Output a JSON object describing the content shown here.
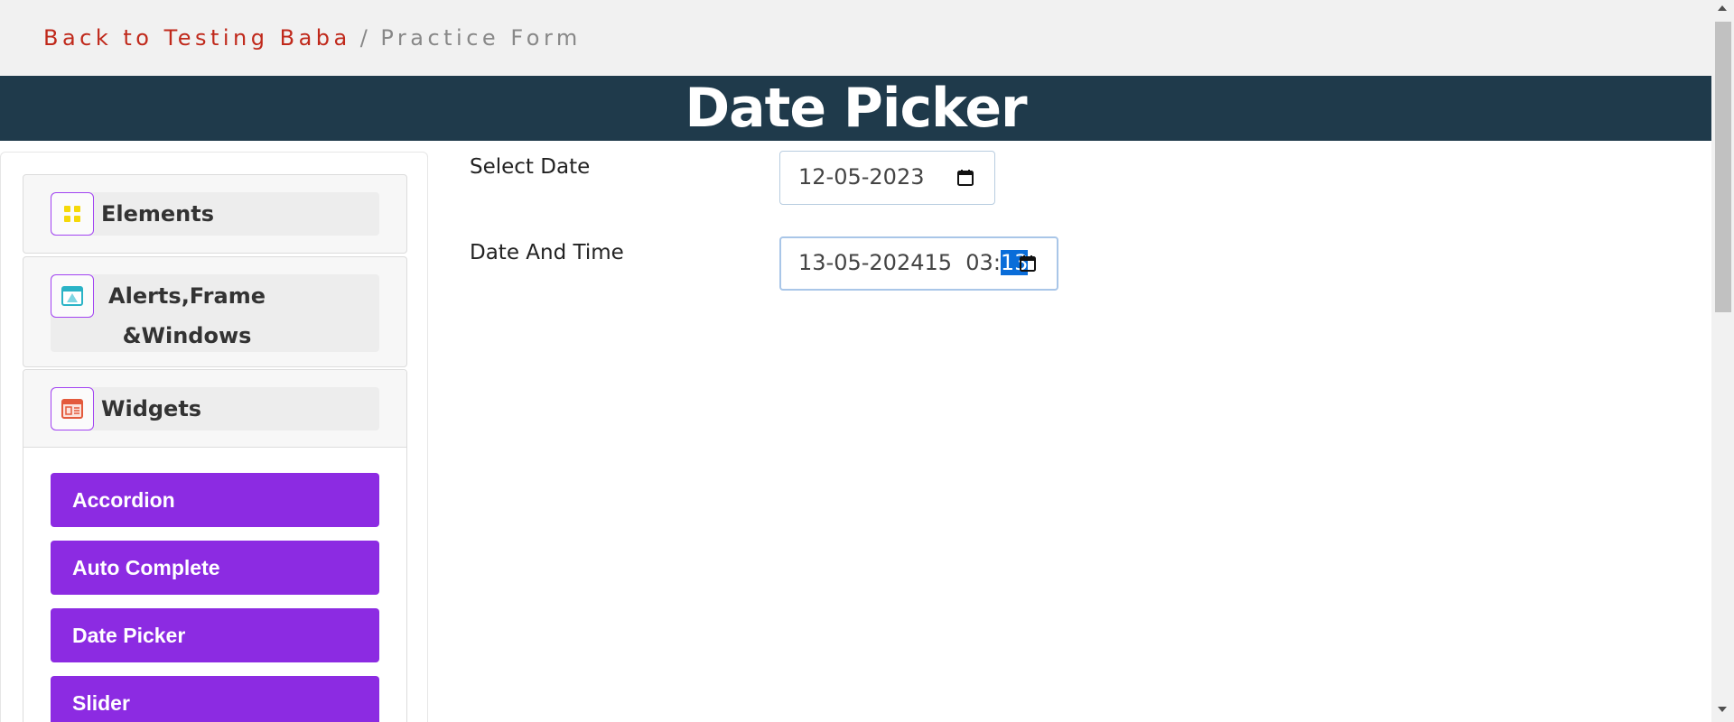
{
  "breadcrumb": {
    "link": "Back to Testing Baba",
    "separator": "/",
    "current": "Practice Form"
  },
  "page_title": "Date Picker",
  "sidebar": {
    "groups": [
      {
        "label": "Elements",
        "icon": "grid-icon"
      },
      {
        "label": "Alerts,Frame &Windows",
        "icon": "window-icon"
      },
      {
        "label": "Widgets",
        "icon": "widgets-icon"
      }
    ],
    "widget_items": [
      {
        "label": "Accordion"
      },
      {
        "label": "Auto Complete"
      },
      {
        "label": "Date Picker"
      },
      {
        "label": "Slider"
      }
    ]
  },
  "form": {
    "select_date": {
      "label": "Select Date",
      "value": "12-05-2023"
    },
    "date_and_time": {
      "label": "Date And Time",
      "value_before": "13-05-202415  03:",
      "value_selected": "13"
    }
  },
  "colors": {
    "accent": "#8c2be2",
    "banner": "#1f3a4b",
    "link": "#c0291b",
    "selection": "#0a6dd9"
  }
}
